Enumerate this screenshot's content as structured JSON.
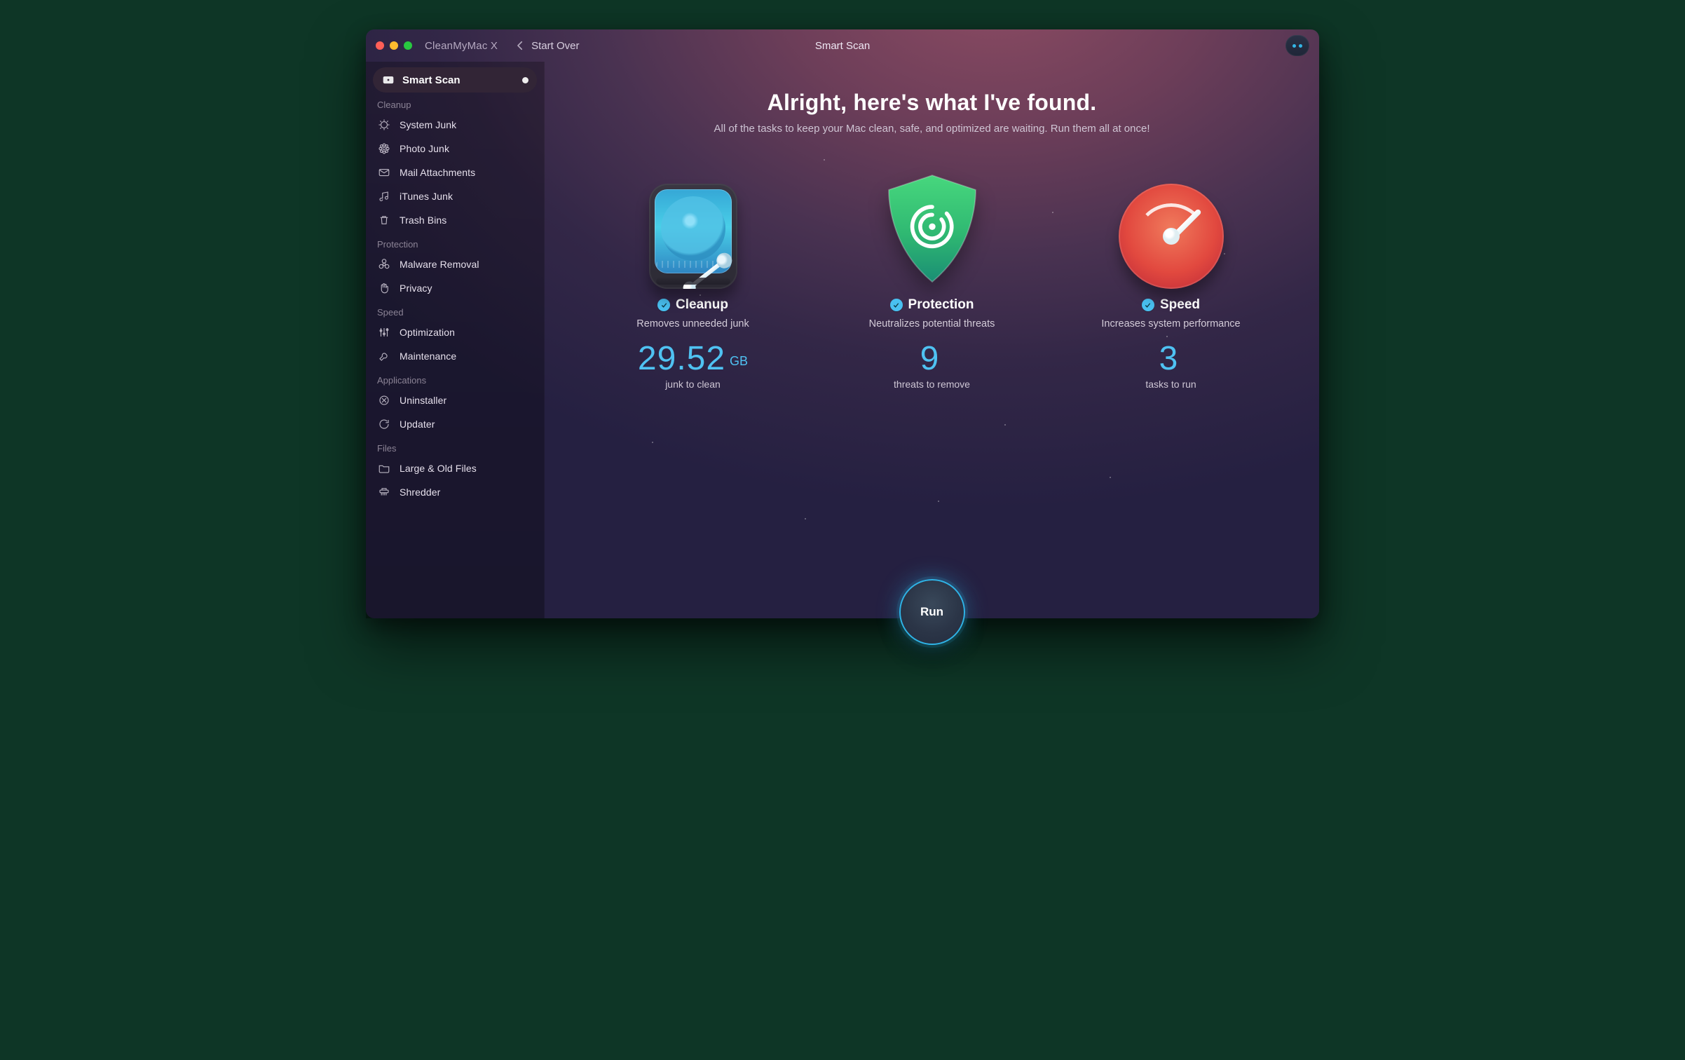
{
  "app": {
    "title": "CleanMyMac X"
  },
  "titlebar": {
    "back_label": "Start Over",
    "center_title": "Smart Scan"
  },
  "sidebar": {
    "active": {
      "label": "Smart Scan"
    },
    "sections": [
      {
        "heading": "Cleanup",
        "items": [
          {
            "label": "System Junk"
          },
          {
            "label": "Photo Junk"
          },
          {
            "label": "Mail Attachments"
          },
          {
            "label": "iTunes Junk"
          },
          {
            "label": "Trash Bins"
          }
        ]
      },
      {
        "heading": "Protection",
        "items": [
          {
            "label": "Malware Removal"
          },
          {
            "label": "Privacy"
          }
        ]
      },
      {
        "heading": "Speed",
        "items": [
          {
            "label": "Optimization"
          },
          {
            "label": "Maintenance"
          }
        ]
      },
      {
        "heading": "Applications",
        "items": [
          {
            "label": "Uninstaller"
          },
          {
            "label": "Updater"
          }
        ]
      },
      {
        "heading": "Files",
        "items": [
          {
            "label": "Large & Old Files"
          },
          {
            "label": "Shredder"
          }
        ]
      }
    ]
  },
  "main": {
    "headline": "Alright, here's what I've found.",
    "subhead": "All of the tasks to keep your Mac clean, safe, and optimized are waiting. Run them all at once!",
    "cards": {
      "cleanup": {
        "title": "Cleanup",
        "desc": "Removes unneeded junk",
        "value": "29.52",
        "unit": "GB",
        "caption": "junk to clean"
      },
      "protection": {
        "title": "Protection",
        "desc": "Neutralizes potential threats",
        "value": "9",
        "unit": "",
        "caption": "threats to remove"
      },
      "speed": {
        "title": "Speed",
        "desc": "Increases system performance",
        "value": "3",
        "unit": "",
        "caption": "tasks to run"
      }
    },
    "run_label": "Run"
  },
  "colors": {
    "accent": "#49c0f0",
    "traffic": {
      "close": "#ff5f57",
      "min": "#febc2e",
      "max": "#28c840"
    }
  }
}
